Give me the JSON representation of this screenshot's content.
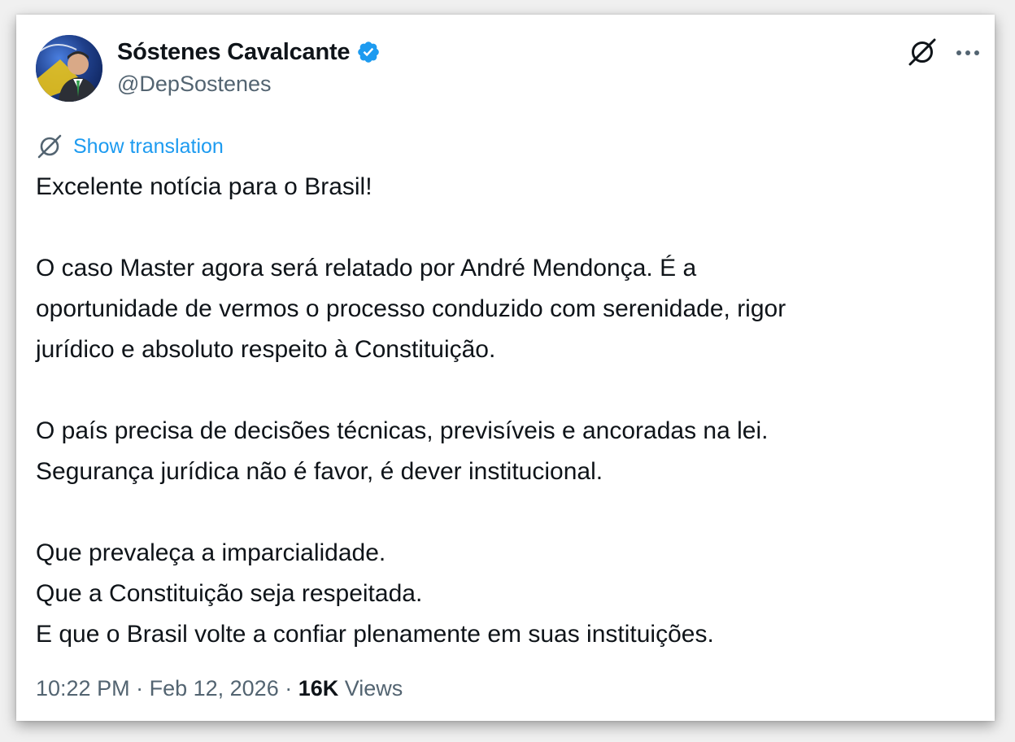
{
  "author": {
    "display_name": "Sóstenes Cavalcante",
    "handle": "@DepSostenes",
    "verified": true
  },
  "actions": {
    "grok_icon": "grok-icon",
    "more_icon": "more-horizontal-icon"
  },
  "translation": {
    "icon": "grok-icon",
    "label": "Show translation"
  },
  "tweet": {
    "paragraphs": [
      [
        "Excelente notícia para o Brasil!"
      ],
      [
        "O caso Master agora será relatado por André Mendonça. É a",
        "oportunidade de vermos o processo conduzido com serenidade, rigor",
        "jurídico e absoluto respeito à Constituição."
      ],
      [
        "O país precisa de decisões técnicas, previsíveis e ancoradas na lei.",
        "Segurança jurídica não é favor, é dever institucional."
      ],
      [
        "Que prevaleça a imparcialidade.",
        "Que a Constituição seja respeitada.",
        "E que o Brasil volte a confiar plenamente em suas instituições."
      ]
    ]
  },
  "meta": {
    "time": "10:22 PM",
    "separator": " · ",
    "date": "Feb 12, 2026",
    "views_count": "16K",
    "views_label": " Views"
  },
  "colors": {
    "accent": "#1d9bf0",
    "text": "#0f1419",
    "secondary": "#536471"
  }
}
